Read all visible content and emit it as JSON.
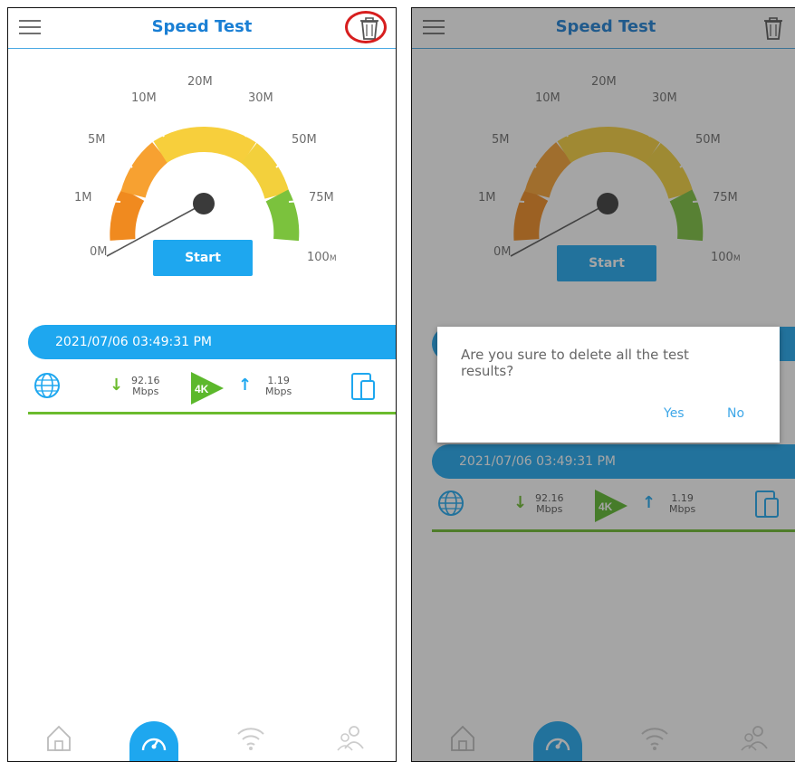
{
  "header": {
    "title": "Speed Test"
  },
  "gauge": {
    "labels": [
      "0M",
      "1M",
      "5M",
      "10M",
      "20M",
      "30M",
      "50M",
      "75M",
      "100M"
    ],
    "label_small_unit": "M",
    "label_100_value": "100",
    "colors": {
      "low": "#f08a1f",
      "mid": "#f7cf3c",
      "high": "#7bc23d",
      "needle": "#555555",
      "hub": "#3a3a3a"
    }
  },
  "start_button": {
    "label": "Start"
  },
  "result": {
    "date": "2021/07/06 03:49:31 PM",
    "download": {
      "value": "92.16",
      "unit": "Mbps"
    },
    "badge": "4K",
    "upload": {
      "value": "1.19",
      "unit": "Mbps"
    }
  },
  "dialog": {
    "message": "Are you sure to delete all the test results?",
    "yes": "Yes",
    "no": "No"
  },
  "colors": {
    "accent": "#1ea7ef",
    "title": "#1a7fd4",
    "green": "#6bbb2d",
    "highlight": "#d71e1e"
  },
  "icons": [
    "menu-icon",
    "trash-icon",
    "globe-icon",
    "download-arrow-icon",
    "upload-arrow-icon",
    "play-4k-icon",
    "devices-icon",
    "home-icon",
    "speedometer-icon",
    "wifi-icon",
    "users-icon"
  ]
}
